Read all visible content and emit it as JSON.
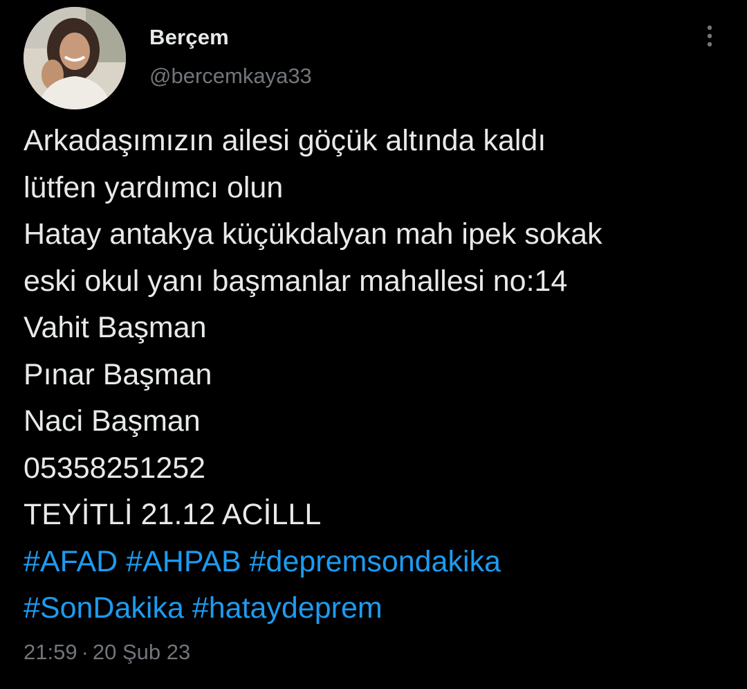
{
  "tweet": {
    "author": {
      "display_name": "Berçem",
      "handle": "@bercemkaya33",
      "avatar_icon": "profile-photo"
    },
    "more_icon": "more-options-icon",
    "text_lines": [
      "Arkadaşımızın ailesi göçük altında kaldı",
      "lütfen yardımcı olun",
      "Hatay antakya küçükdalyan mah ipek sokak",
      "eski okul yanı başmanlar mahallesi no:14",
      "Vahit Başman",
      "Pınar Başman",
      "Naci Başman",
      "05358251252",
      "TEYİTLİ 21.12 ACİLLL"
    ],
    "hashtags_line1": [
      "#AFAD",
      "#AHPAB",
      "#depremsondakika"
    ],
    "hashtags_line2": [
      "#SonDakika",
      "#hataydeprem"
    ],
    "time": "21:59",
    "separator": "·",
    "date": "20 Şub 23",
    "colors": {
      "background": "#000000",
      "text": "#e7e9ea",
      "secondary": "#71767b",
      "link": "#1d9bf0"
    }
  }
}
